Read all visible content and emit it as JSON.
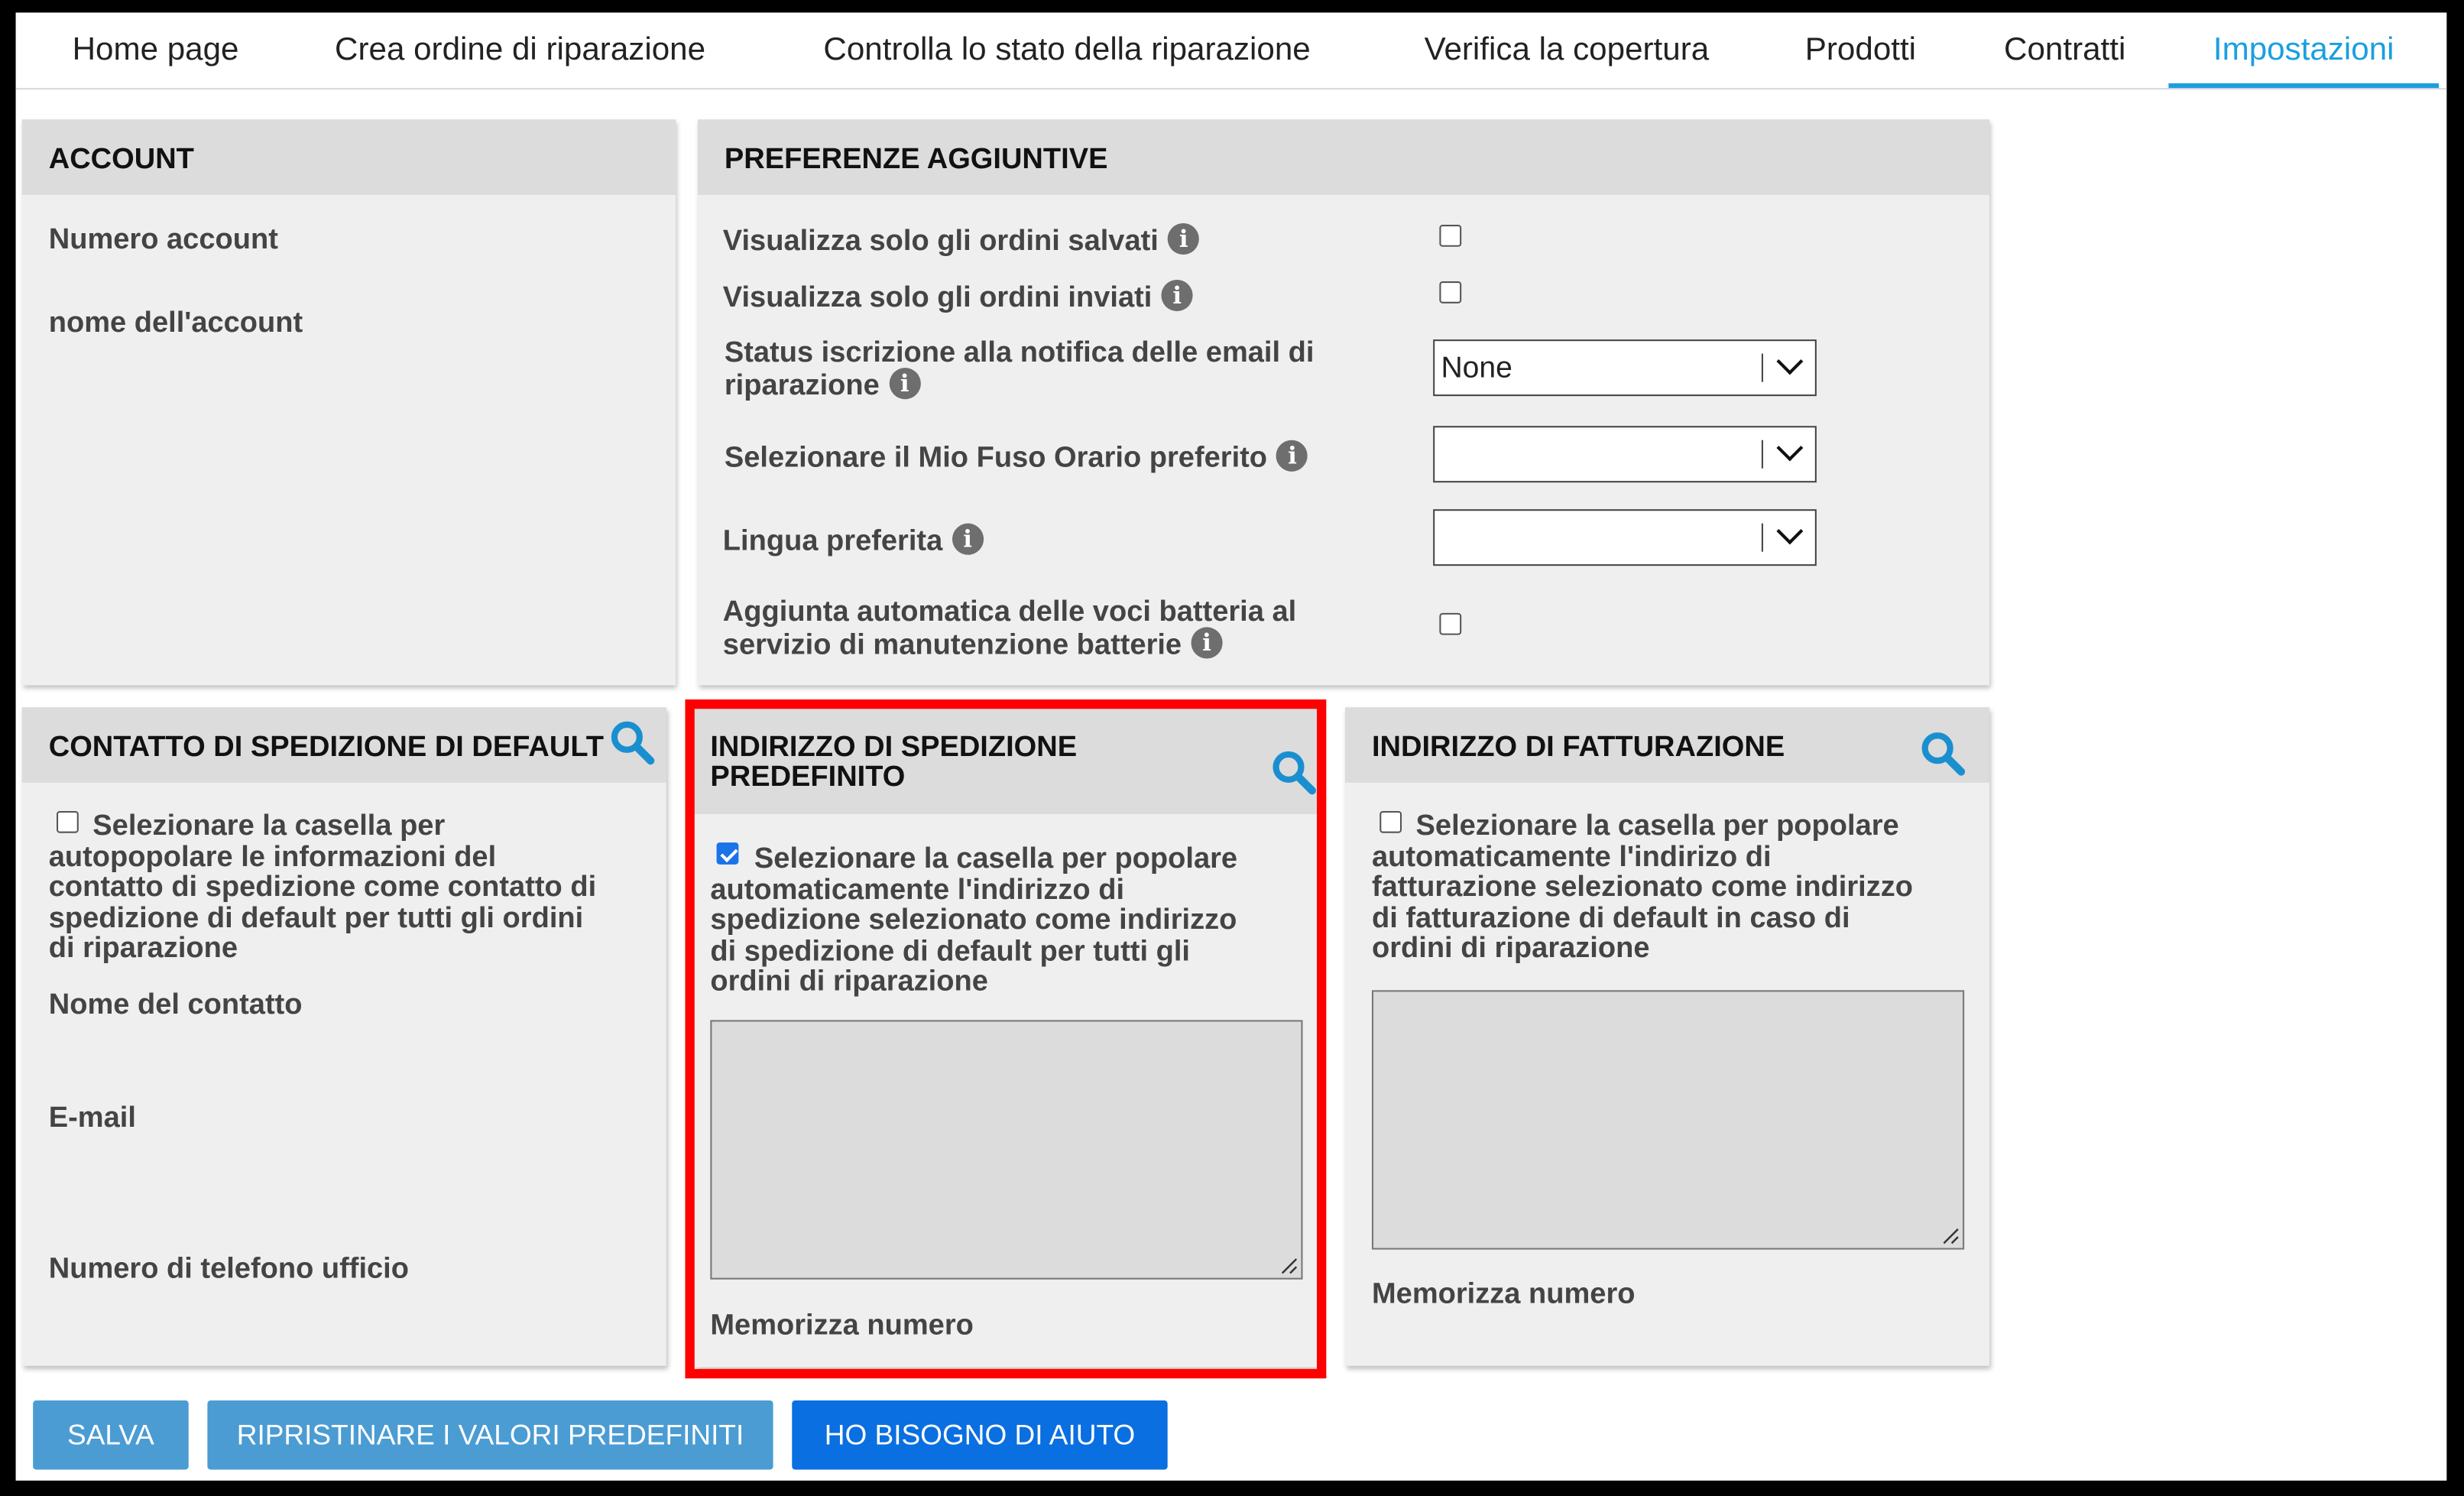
{
  "tabs": [
    {
      "label": "Home page"
    },
    {
      "label": "Crea ordine di riparazione"
    },
    {
      "label": "Controlla lo stato della riparazione"
    },
    {
      "label": "Verifica la copertura"
    },
    {
      "label": "Prodotti"
    },
    {
      "label": "Contratti"
    },
    {
      "label": "Impostazioni",
      "active": true
    }
  ],
  "account": {
    "title": "ACCOUNT",
    "number_label": "Numero account",
    "name_label": "nome dell'account"
  },
  "prefs": {
    "title": "PREFERENZE AGGIUNTIVE",
    "saved_only": {
      "label": "Visualizza solo gli ordini salvati",
      "checked": false
    },
    "sent_only": {
      "label": "Visualizza solo gli ordini inviati",
      "checked": false
    },
    "email_status": {
      "label_line1": "Status iscrizione alla notifica delle email di",
      "label_line2": "riparazione",
      "value": "None"
    },
    "timezone": {
      "label": "Selezionare il Mio Fuso Orario preferito",
      "value": ""
    },
    "language": {
      "label": "Lingua preferita",
      "value": ""
    },
    "battery": {
      "label_line1": "Aggiunta automatica delle voci batteria al",
      "label_line2": "servizio di manutenzione batterie",
      "checked": false
    }
  },
  "shipping_contact": {
    "title": "CONTATTO DI SPEDIZIONE DI DEFAULT",
    "checkbox_lines": [
      "Selezionare la casella per",
      "autopopolare le informazioni del",
      "contatto di spedizione come contatto di",
      "spedizione di default per tutti gli ordini",
      "di riparazione"
    ],
    "checked": false,
    "contact_name_label": "Nome del contatto",
    "email_label": "E-mail",
    "phone_label": "Numero di telefono ufficio"
  },
  "shipping_address": {
    "title_line1": "INDIRIZZO DI SPEDIZIONE",
    "title_line2": "PREDEFINITO",
    "checkbox_lines": [
      "Selezionare la casella per popolare",
      "automaticamente l'indirizzo di",
      "spedizione selezionato come indirizzo",
      "di spedizione di default per tutti gli",
      "ordini di riparazione"
    ],
    "checked": true,
    "store_label": "Memorizza numero"
  },
  "billing_address": {
    "title": "INDIRIZZO DI FATTURAZIONE",
    "checkbox_lines": [
      "Selezionare la casella per popolare",
      "automaticamente l'indirizo di",
      "fatturazione selezionato come indirizzo",
      "di fatturazione di default in caso di",
      "ordini di riparazione"
    ],
    "checked": false,
    "store_label": "Memorizza numero"
  },
  "buttons": {
    "save": "SALVA",
    "reset": "RIPRISTINARE I VALORI PREDEFINITI",
    "help": "HO BISOGNO DI AIUTO"
  },
  "icons": {
    "info": "info-icon",
    "search": "search-icon"
  },
  "colors": {
    "accent": "#1a9fe0",
    "button_blue": "#4b9cd3",
    "help_blue": "#0a6fe0",
    "highlight": "#ff0000"
  }
}
